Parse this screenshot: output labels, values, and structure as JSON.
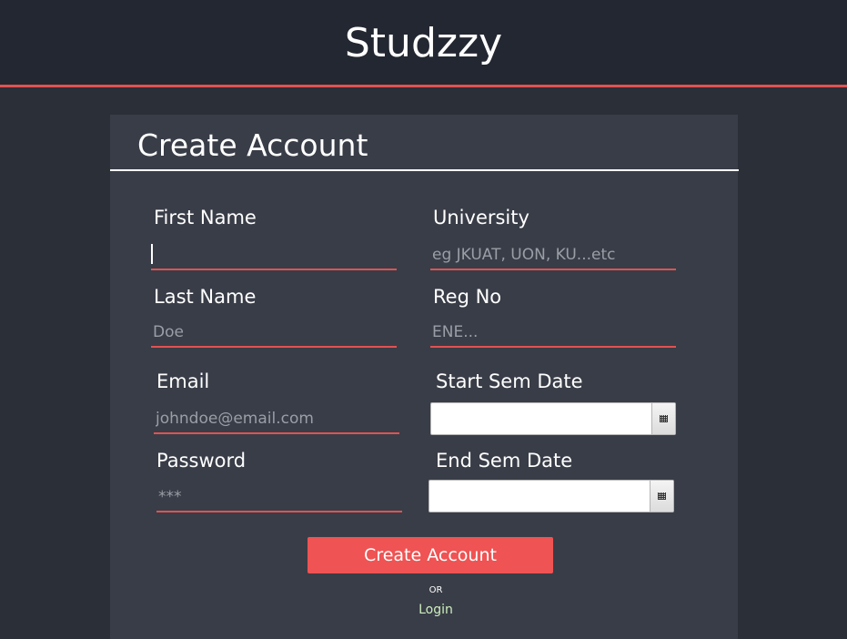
{
  "app": {
    "title": "Studzzy"
  },
  "form": {
    "title": "Create Account",
    "first_name": {
      "label": "First Name",
      "value": "",
      "placeholder": ""
    },
    "last_name": {
      "label": "Last Name",
      "value": "",
      "placeholder": "Doe"
    },
    "email": {
      "label": "Email",
      "value": "",
      "placeholder": "johndoe@email.com"
    },
    "password": {
      "label": "Password",
      "value": "",
      "placeholder": "***"
    },
    "university": {
      "label": "University",
      "value": "",
      "placeholder": "eg JKUAT, UON, KU...etc"
    },
    "reg_no": {
      "label": "Reg No",
      "value": "",
      "placeholder": "ENE..."
    },
    "start_sem_date": {
      "label": "Start Sem Date",
      "value": ""
    },
    "end_sem_date": {
      "label": "End Sem Date",
      "value": ""
    },
    "submit_label": "Create Account",
    "or_text": "OR",
    "login_label": "Login"
  },
  "colors": {
    "accent": "#e05252",
    "button": "#ef5353",
    "card_bg": "#393d47",
    "header_bg": "#232731",
    "page_bg": "#2b2f38",
    "link": "#cdeebc"
  },
  "icons": {
    "date_picker": "calendar-icon"
  }
}
